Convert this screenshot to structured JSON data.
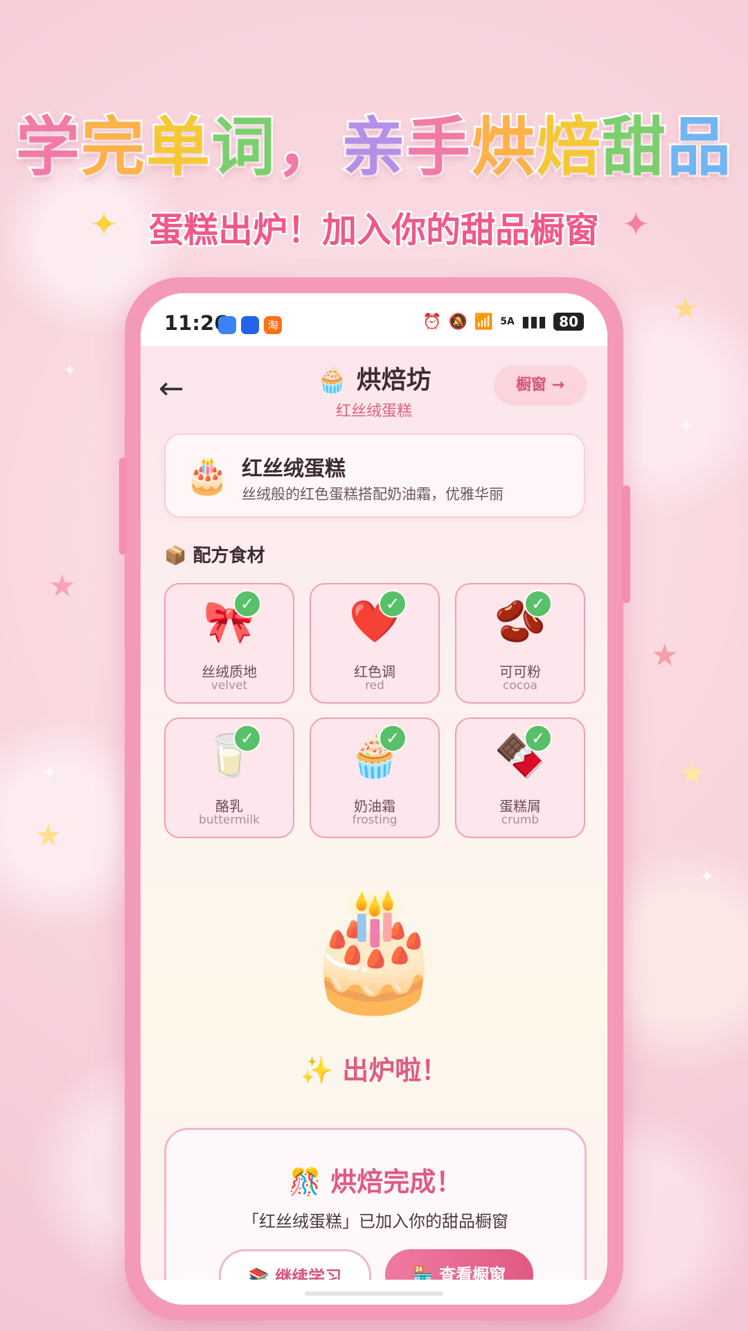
{
  "promo": {
    "headline_parts": [
      {
        "text": "学",
        "color": "#f27aa7"
      },
      {
        "text": "完",
        "color": "#ffb14a"
      },
      {
        "text": "单",
        "color": "#f5c935"
      },
      {
        "text": "词",
        "color": "#7ccf6e"
      },
      {
        "text": "，",
        "color": "#f27aa7"
      },
      {
        "text": "亲",
        "color": "#b48fe8"
      },
      {
        "text": "手",
        "color": "#f27aa7"
      },
      {
        "text": "烘",
        "color": "#ffb14a"
      },
      {
        "text": "焙",
        "color": "#f5c935"
      },
      {
        "text": "甜",
        "color": "#7ccf6e"
      },
      {
        "text": "品",
        "color": "#6fb6f2"
      }
    ],
    "subline": "蛋糕出炉！加入你的甜品橱窗"
  },
  "status_bar": {
    "time": "11:26",
    "app_icons": [
      {
        "name": "message-app-icon",
        "color": "#3b82f6",
        "glyph": ""
      },
      {
        "name": "bulb-app-icon",
        "color": "#2563eb",
        "glyph": ""
      },
      {
        "name": "taobao-app-icon",
        "color": "#f97316",
        "glyph": "淘"
      }
    ],
    "signal_label": "5A",
    "battery": "80"
  },
  "header": {
    "back": "←",
    "title_icon": "🧁",
    "title": "烘焙坊",
    "subtitle": "红丝绒蛋糕",
    "showcase_button": "橱窗 →"
  },
  "recipe": {
    "icon": "🎂",
    "name": "红丝绒蛋糕",
    "description": "丝绒般的红色蛋糕搭配奶油霜，优雅华丽"
  },
  "ingredients_section": {
    "icon": "📦",
    "title": "配方食材"
  },
  "ingredients": [
    {
      "emoji": "🎀",
      "cn": "丝绒质地",
      "en": "velvet",
      "checked": true
    },
    {
      "emoji": "❤️",
      "cn": "红色调",
      "en": "red",
      "checked": true
    },
    {
      "emoji": "🫘",
      "cn": "可可粉",
      "en": "cocoa",
      "checked": true
    },
    {
      "emoji": "🥛",
      "cn": "酪乳",
      "en": "buttermilk",
      "checked": true
    },
    {
      "emoji": "🧁",
      "cn": "奶油霜",
      "en": "frosting",
      "checked": true
    },
    {
      "emoji": "🍫",
      "cn": "蛋糕屑",
      "en": "crumb",
      "checked": true
    }
  ],
  "baked": {
    "cake": "🎂",
    "text": "✨ 出炉啦！"
  },
  "completion": {
    "title": "🎊 烘焙完成！",
    "message": "「红丝绒蛋糕」已加入你的甜品橱窗",
    "continue_button": "📚 继续学习",
    "view_button": "🏪 查看橱窗"
  }
}
